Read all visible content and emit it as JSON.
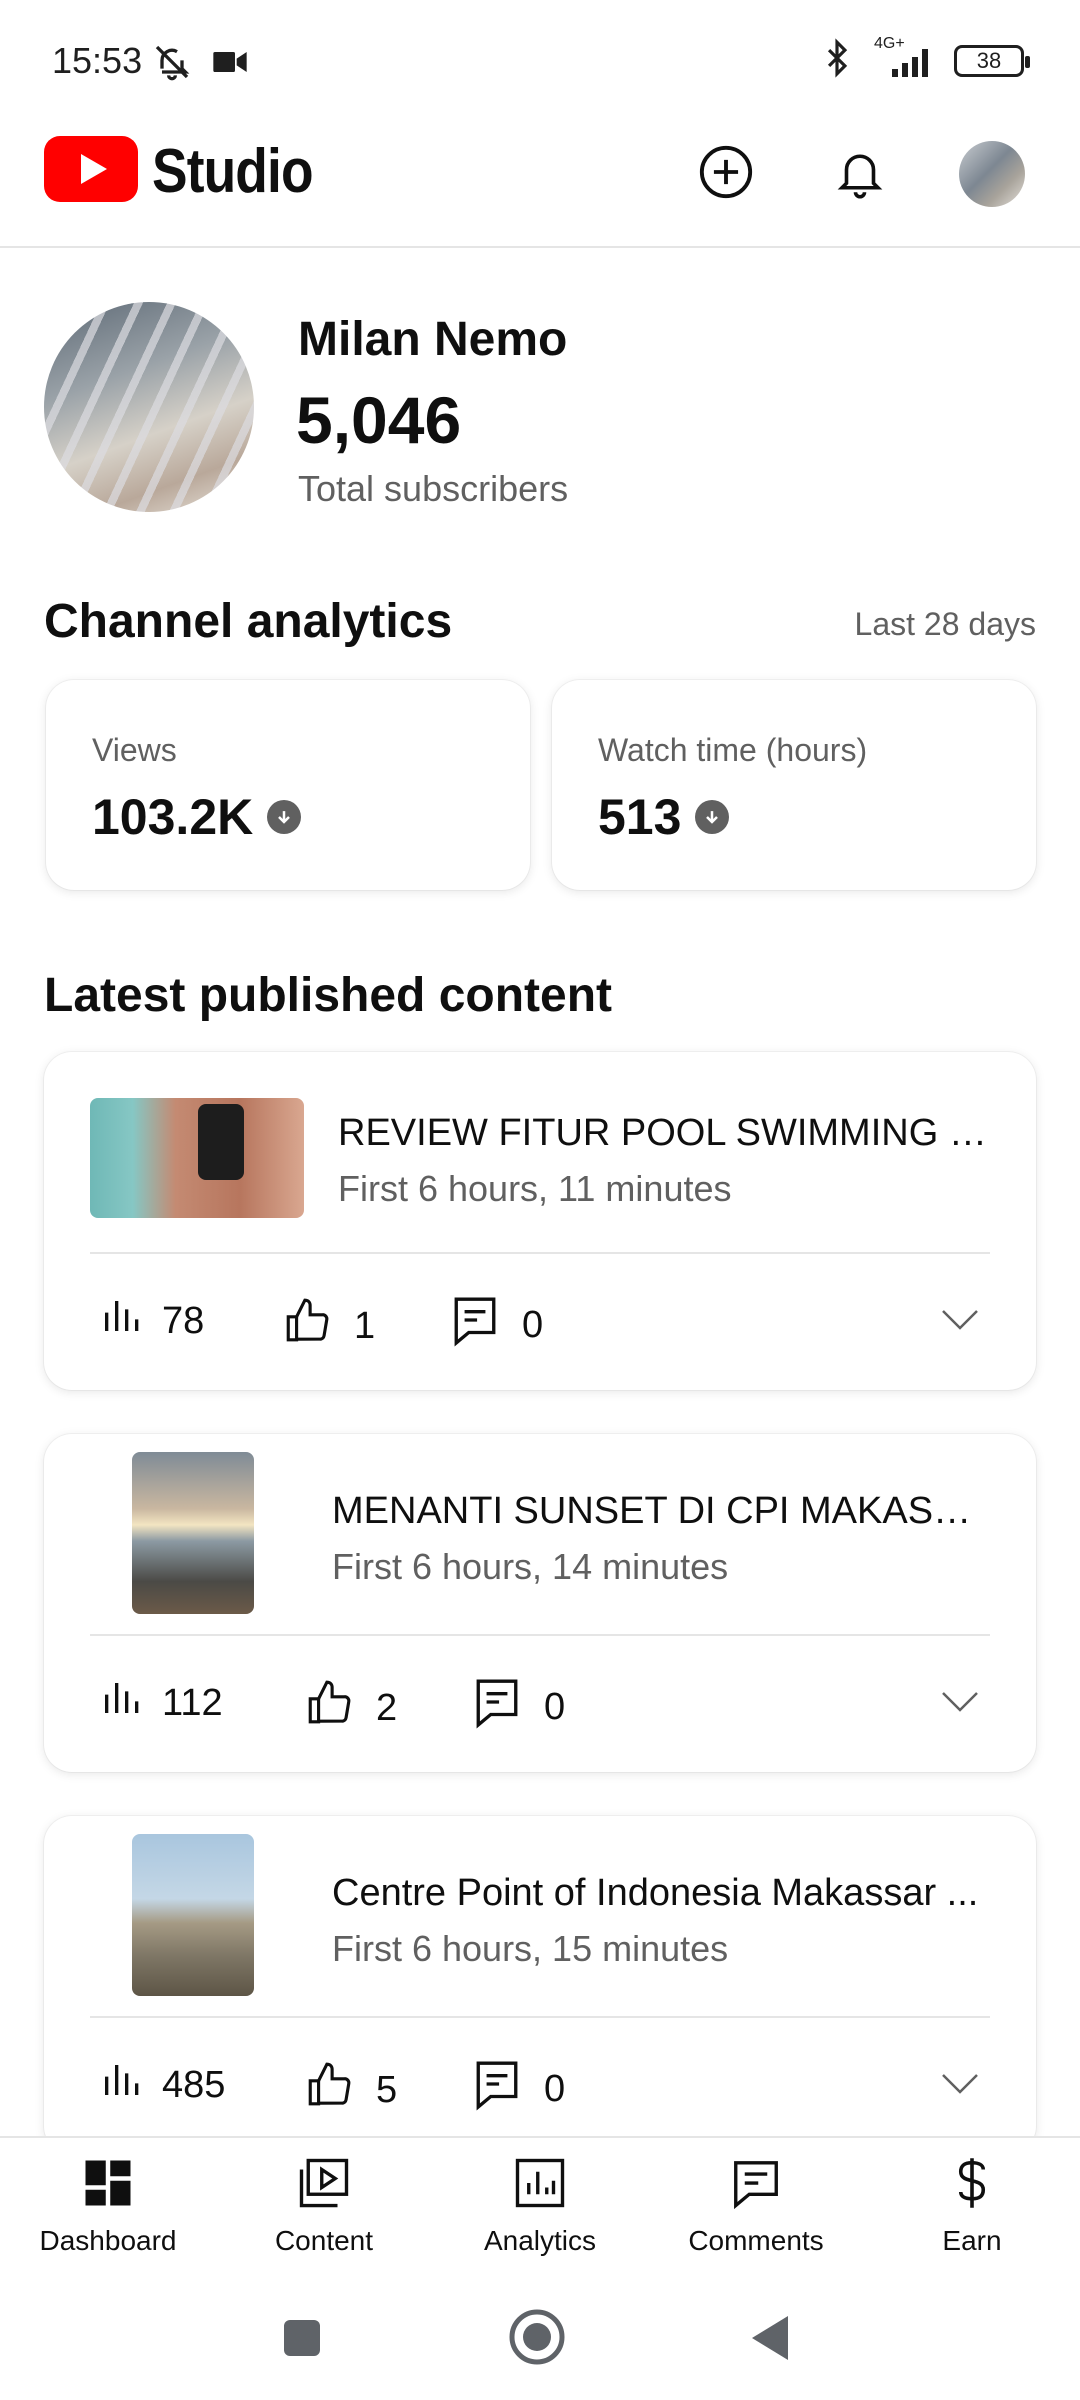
{
  "status_bar": {
    "time": "15:53",
    "network": "4G+",
    "battery": "38"
  },
  "app_bar": {
    "title": "Studio"
  },
  "profile": {
    "channel_name": "Milan Nemo",
    "subscriber_count": "5,046",
    "subscriber_label": "Total subscribers"
  },
  "analytics": {
    "title": "Channel analytics",
    "range": "Last 28 days",
    "metrics": [
      {
        "label": "Views",
        "value": "103.2K",
        "trend": "down"
      },
      {
        "label": "Watch time (hours)",
        "value": "513",
        "trend": "down"
      }
    ]
  },
  "latest": {
    "title": "Latest published content",
    "videos": [
      {
        "title": "REVIEW FITUR POOL SWIMMING XI...",
        "time": "First 6 hours, 11 minutes",
        "views": "78",
        "likes": "1",
        "comments": "0"
      },
      {
        "title": "MENANTI SUNSET DI CPI MAKASSAR",
        "time": "First 6 hours, 14 minutes",
        "views": "112",
        "likes": "2",
        "comments": "0"
      },
      {
        "title": "Centre Point of Indonesia Makassar ...",
        "time": "First 6 hours, 15 minutes",
        "views": "485",
        "likes": "5",
        "comments": "0"
      }
    ]
  },
  "bottom_nav": {
    "items": [
      {
        "label": "Dashboard",
        "icon": "dashboard-icon"
      },
      {
        "label": "Content",
        "icon": "content-icon"
      },
      {
        "label": "Analytics",
        "icon": "analytics-icon"
      },
      {
        "label": "Comments",
        "icon": "comments-icon"
      },
      {
        "label": "Earn",
        "icon": "earn-icon"
      }
    ]
  },
  "colors": {
    "brand_red": "#ff0000",
    "secondary_text": "#606060"
  }
}
